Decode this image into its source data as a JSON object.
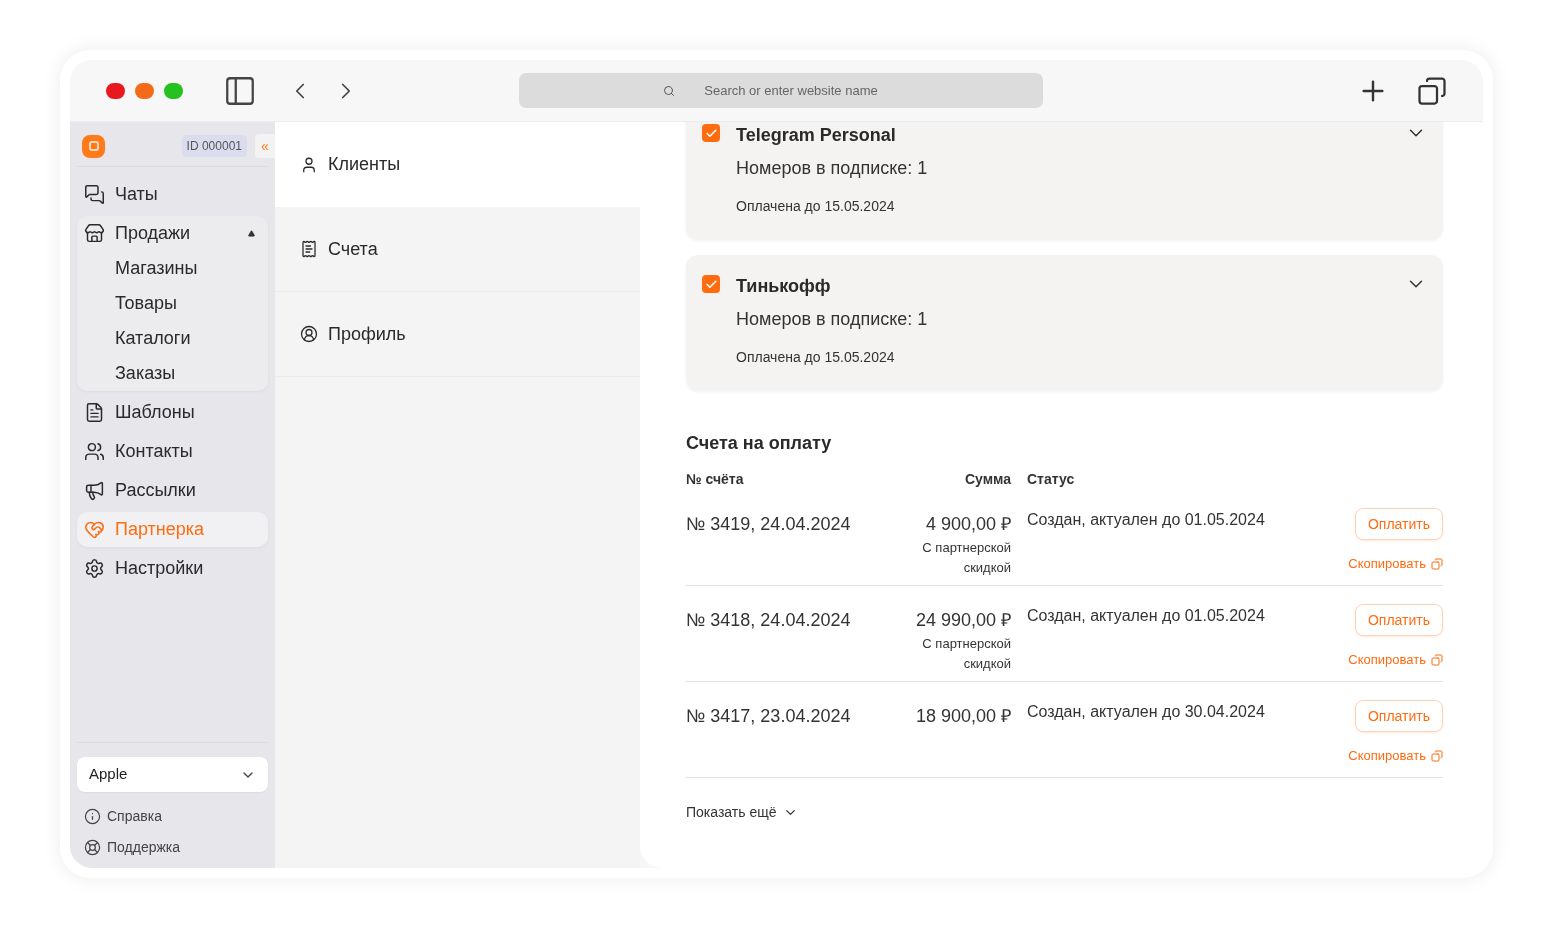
{
  "browser": {
    "search": {
      "placeholder": "Search or enter website name"
    }
  },
  "sidebar": {
    "id_badge": "ID 000001",
    "collapse": "«",
    "items": [
      {
        "label": "Чаты",
        "selected": false
      },
      {
        "label": "Продажи",
        "selected": false,
        "expanded": true,
        "children": [
          {
            "label": "Магазины"
          },
          {
            "label": "Товары"
          },
          {
            "label": "Каталоги"
          },
          {
            "label": "Заказы"
          }
        ]
      },
      {
        "label": "Шаблоны",
        "selected": false
      },
      {
        "label": "Контакты",
        "selected": false
      },
      {
        "label": "Рассылки",
        "selected": false
      },
      {
        "label": "Партнерка",
        "selected": true
      },
      {
        "label": "Настройки",
        "selected": false
      }
    ],
    "account_select": {
      "value": "Apple"
    },
    "footer_links": [
      {
        "label": "Справка"
      },
      {
        "label": "Поддержка"
      }
    ]
  },
  "subnav": [
    {
      "label": "Клиенты",
      "selected": true
    },
    {
      "label": "Счета",
      "selected": false
    },
    {
      "label": "Профиль",
      "selected": false
    }
  ],
  "subscriptions": [
    {
      "title": "Telegram Personal",
      "checked": true,
      "numbers": "Номеров в подписке: 1",
      "paid_until": "Оплачена до 15.05.2024"
    },
    {
      "title": "Тинькофф",
      "checked": true,
      "numbers": "Номеров в подписке: 1",
      "paid_until": "Оплачена до 15.05.2024"
    }
  ],
  "invoices": {
    "title": "Счета на оплату",
    "columns": [
      "№ счёта",
      "Сумма",
      "Статус"
    ],
    "rows": [
      {
        "number": "№ 3419, 24.04.2024",
        "amount": "4 900,00 ₽",
        "amount_note": "С партнерской скидкой",
        "status": "Создан, актуален до 01.05.2024",
        "pay": "Оплатить",
        "copy": "Скопировать"
      },
      {
        "number": "№ 3418, 24.04.2024",
        "amount": "24 990,00 ₽",
        "amount_note": "С партнерской скидкой",
        "status": "Создан, актуален до 01.05.2024",
        "pay": "Оплатить",
        "copy": "Скопировать"
      },
      {
        "number": "№ 3417, 23.04.2024",
        "amount": "18 900,00 ₽",
        "status": "Создан, актуален до 30.04.2024",
        "pay": "Оплатить",
        "copy": "Скопировать"
      }
    ],
    "show_more": "Показать ещё"
  }
}
